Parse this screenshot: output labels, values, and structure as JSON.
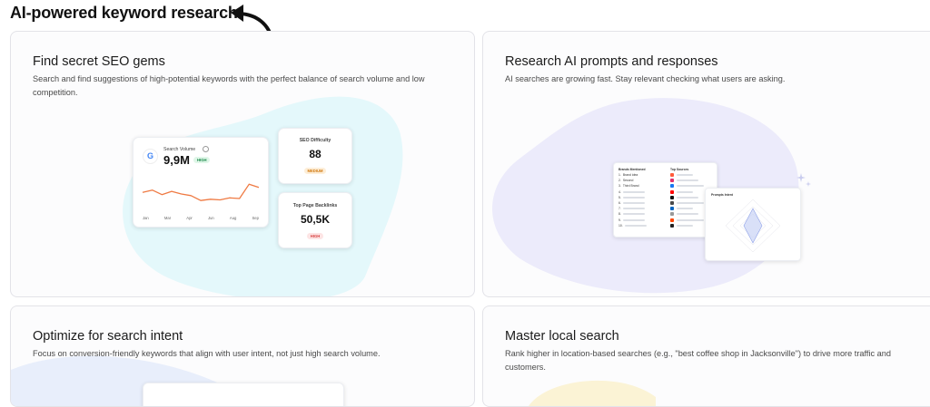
{
  "page_title": "AI-powered keyword research",
  "cards": [
    {
      "title": "Find secret SEO gems",
      "description": "Search and find suggestions of high-potential keywords with the perfect balance of search volume and low competition."
    },
    {
      "title": "Research AI prompts and responses",
      "description": "AI searches are growing fast. Stay relevant checking what users are asking."
    },
    {
      "title": "Optimize for search intent",
      "description": "Focus on conversion-friendly keywords that align with user intent, not just high search volume."
    },
    {
      "title": "Master local search",
      "description": "Rank higher in location-based searches (e.g., \"best coffee shop in Jacksonville\") to drive more traffic and customers."
    }
  ],
  "search_volume": {
    "label": "Search Volume",
    "value": "9,9M",
    "badge": "HIGH",
    "months": [
      "Jan",
      "Mar",
      "Apr",
      "Jun",
      "Aug",
      "Sep"
    ],
    "trend": [
      0.55,
      0.62,
      0.48,
      0.58,
      0.5,
      0.45,
      0.3,
      0.34,
      0.32,
      0.38,
      0.36,
      0.8,
      0.7
    ]
  },
  "seo_difficulty": {
    "label": "SEO Difficulty",
    "value": "88",
    "badge": "MEDIUM"
  },
  "backlinks": {
    "label": "Top Page Backlinks",
    "value": "50,5K",
    "badge": "HIGH"
  },
  "ai_table": {
    "brands_header": "Brands Mentioned",
    "sources_header": "Top Sources",
    "brands": [
      {
        "num": "1.",
        "name": "Brand idea"
      },
      {
        "num": "2.",
        "name": "Second"
      },
      {
        "num": "3.",
        "name": "Third Brand"
      },
      {
        "num": "4.",
        "name": ""
      },
      {
        "num": "5.",
        "name": ""
      },
      {
        "num": "6.",
        "name": ""
      },
      {
        "num": "7.",
        "name": ""
      },
      {
        "num": "8.",
        "name": ""
      },
      {
        "num": "9.",
        "name": ""
      },
      {
        "num": "10.",
        "name": ""
      }
    ],
    "source_colors": [
      "#ff5b3a",
      "#e1306c",
      "#1877f2",
      "#ff0000",
      "#111111",
      "#4a4a4a",
      "#0a66c2",
      "#999999",
      "#ff4500",
      "#222222"
    ],
    "radar_title": "Prompts Intent"
  },
  "colors": {
    "accent_orange": "#ef7a43",
    "blob_cyan": "#e4f8fb",
    "blob_lavender": "#ecebfb",
    "blob_blue": "#e8eefb",
    "blob_yellow": "#fbf3d5"
  }
}
